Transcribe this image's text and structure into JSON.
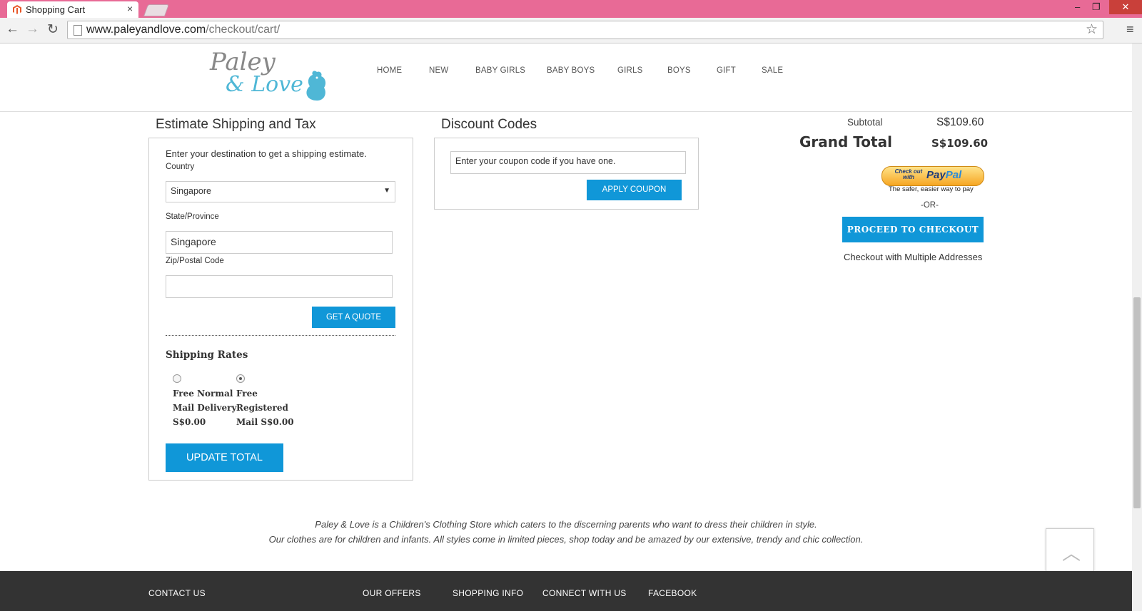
{
  "browser": {
    "tab_title": "Shopping Cart",
    "tab_close": "×",
    "url_host": "www.paleyandlove.com",
    "url_path": "/checkout/cart/",
    "win_minimize": "–",
    "win_restore": "❐",
    "win_close": "✕",
    "back": "←",
    "forward": "→",
    "reload": "↻",
    "star": "☆",
    "menu": "≡"
  },
  "site": {
    "logo_text_line1": "Paley",
    "logo_text_line2": "& Love",
    "nav": [
      "HOME",
      "NEW",
      "BABY GIRLS",
      "BABY BOYS",
      "GIRLS",
      "BOYS",
      "GIFT",
      "SALE"
    ]
  },
  "shipping": {
    "title": "Estimate Shipping and Tax",
    "intro": "Enter your destination to get a shipping estimate.",
    "country_label": "Country",
    "country_value": "Singapore",
    "state_label": "State/Province",
    "state_value": "Singapore",
    "zip_label": "Zip/Postal Code",
    "zip_value": "",
    "quote_button": "GET A QUOTE",
    "rates_title": "Shipping Rates",
    "rate1": [
      "Free Normal",
      "Mail Delivery",
      "S$0.00"
    ],
    "rate2": [
      "Free",
      "Registered",
      "Mail S$0.00"
    ],
    "update_button": "UPDATE TOTAL"
  },
  "discount": {
    "title": "Discount Codes",
    "placeholder": "Enter your coupon code if you have one.",
    "apply_button": "APPLY COUPON"
  },
  "totals": {
    "subtotal_label": "Subtotal",
    "subtotal_value": "S$109.60",
    "grand_label": "Grand Total",
    "grand_value": "S$109.60",
    "paypal_small": "Check out with",
    "paypal_pay": "Pay",
    "paypal_pal": "Pal",
    "paypal_tag": "The safer, easier way to pay",
    "or": "-OR-",
    "checkout_button": "PROCEED TO CHECKOUT",
    "multi_link": "Checkout with Multiple Addresses"
  },
  "footer": {
    "line1": "Paley & Love is a Children's Clothing Store which caters to the discerning parents who want to dress their children in style.",
    "line2": "Our clothes are for children and infants. All styles come in limited pieces, shop today and be amazed by our extensive, trendy and chic collection.",
    "to_top": "︿",
    "links": [
      "CONTACT US",
      "OUR OFFERS",
      "SHOPPING INFO",
      "CONNECT WITH US",
      "FACEBOOK"
    ]
  },
  "colors": {
    "accent": "#1097d8",
    "tabbar": "#e86a96",
    "footer": "#333333"
  }
}
